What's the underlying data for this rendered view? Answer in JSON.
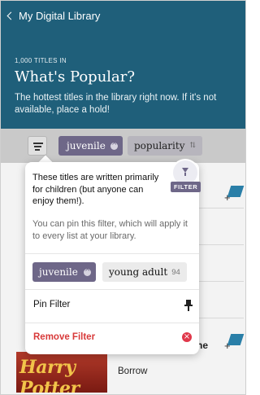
{
  "header": {
    "back_label": "My Digital Library",
    "count_label": "1,000 TITLES IN",
    "title": "What's Popular?",
    "subtitle": "The hottest titles in the library right now. If it's not available, place a hold!"
  },
  "filter_bar": {
    "active_filter": "juvenile",
    "sort_label": "popularity"
  },
  "popover": {
    "badge_label": "FILTER",
    "description": "These titles are written primarily for children (but anyone can enjoy them!).",
    "hint": "You can pin this filter, which will apply it to every list at your library.",
    "chips": [
      {
        "label": "juvenile",
        "selected": true
      },
      {
        "label": "young adult",
        "count": "94",
        "selected": false
      }
    ],
    "pin_label": "Pin Filter",
    "remove_label": "Remove Filter"
  },
  "list": {
    "partial_text": "ne",
    "cover_text": "Harry Potter",
    "borrow_label": "Borrow"
  },
  "colors": {
    "header_bg": "#1f5f7a",
    "chip_accent": "#6e6788",
    "remove_red": "#d83a3a",
    "add_blue": "#2a7fa8"
  },
  "icons": {
    "back": "chevron-left-icon",
    "menu": "filter-menu-icon",
    "funnel": "funnel-icon",
    "pin": "pin-icon",
    "remove": "remove-circle-icon",
    "add_to_list": "add-to-list-icon"
  }
}
